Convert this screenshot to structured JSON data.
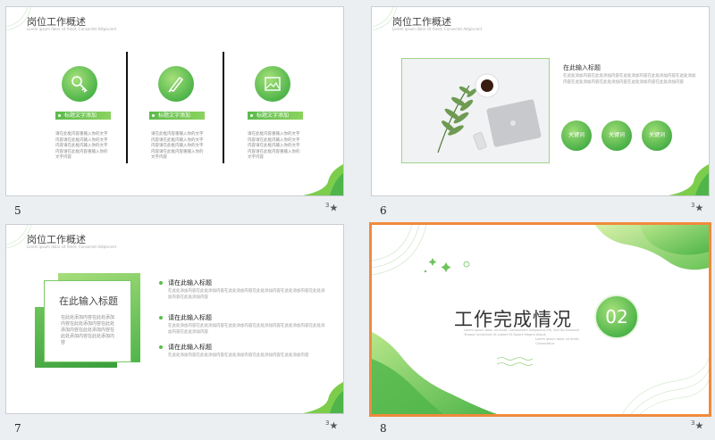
{
  "slides": [
    {
      "number": "5",
      "title": "岗位工作概述",
      "subtitle": "Lorem ipsum dolor sit Amet, Consectet Adipiscent",
      "columns": [
        {
          "icon": "key-icon",
          "pill": "标题文字添加",
          "text": "请在此框内容重输入你的文字内容请在此框内输入你的文字内容请在此框内输入你的文字内容请在此框内容重输入你的文字内容"
        },
        {
          "icon": "pencil-icon",
          "pill": "标题文字添加",
          "text": "请在此框内容重输入你的文字内容请在此框内输入你的文字内容请在此框内输入你的文字内容请在此框内容重输入你的文字内容"
        },
        {
          "icon": "image-icon",
          "pill": "标题文字添加",
          "text": "请在此框内容重输入你的文字内容请在此框内输入你的文字内容请在此框内输入你的文字内容请在此框内容重输入你的文字内容"
        }
      ]
    },
    {
      "number": "6",
      "title": "岗位工作概述",
      "subtitle": "Lorem ipsum dolor sit Amet, Consectet Adipiscent",
      "heading": "在此输入标题",
      "text": "在此处添加内容在此处添加内容在此处添加内容在此处添加内容在此处添加内容在此处添加内容在此处添加内容在此处添加内容在此处添加内容",
      "keywords": [
        "关键词",
        "关键词",
        "关键词"
      ]
    },
    {
      "number": "7",
      "title": "岗位工作概述",
      "subtitle": "Lorem ipsum dolor sit Amet, Consectet Adipiscent",
      "box_title": "在此输入标题",
      "box_text": "在此处添加内容在此处添加内容在此处添加内容在此处添加内容在此处添加内容在此处添加内容在此处添加内容",
      "items": [
        {
          "heading": "请在此输入标题",
          "text": "在此处添加内容在此处添加内容在此处添加内容在此处添加内容在此处添加内容在此处添加内容在此处添加内容"
        },
        {
          "heading": "请在此输入标题",
          "text": "在此处添加内容在此处添加内容在此处添加内容在此处添加内容在此处添加内容在此处添加内容在此处添加内容"
        },
        {
          "heading": "请在此输入标题",
          "text": "在此处添加内容在此处添加内容在此处添加内容在此处添加内容在此处添加内容"
        }
      ]
    },
    {
      "number": "8",
      "title": "工作完成情况",
      "badge": "02",
      "subtitle": "Lorem ipsum dolor sit Amet, Consectetur Adipiscent Elit, Sed Do Eiusmod Tempor Incididunt Ut Labore Et Dolore Magna Aliqua",
      "subtitle2": "Lorem ipsum dolor sit Amet, Consectetur",
      "selected": true
    }
  ],
  "star_label": "★",
  "star_sup": "3",
  "colors": {
    "accent": "#5bbb4a",
    "selection": "#f08a3c"
  }
}
